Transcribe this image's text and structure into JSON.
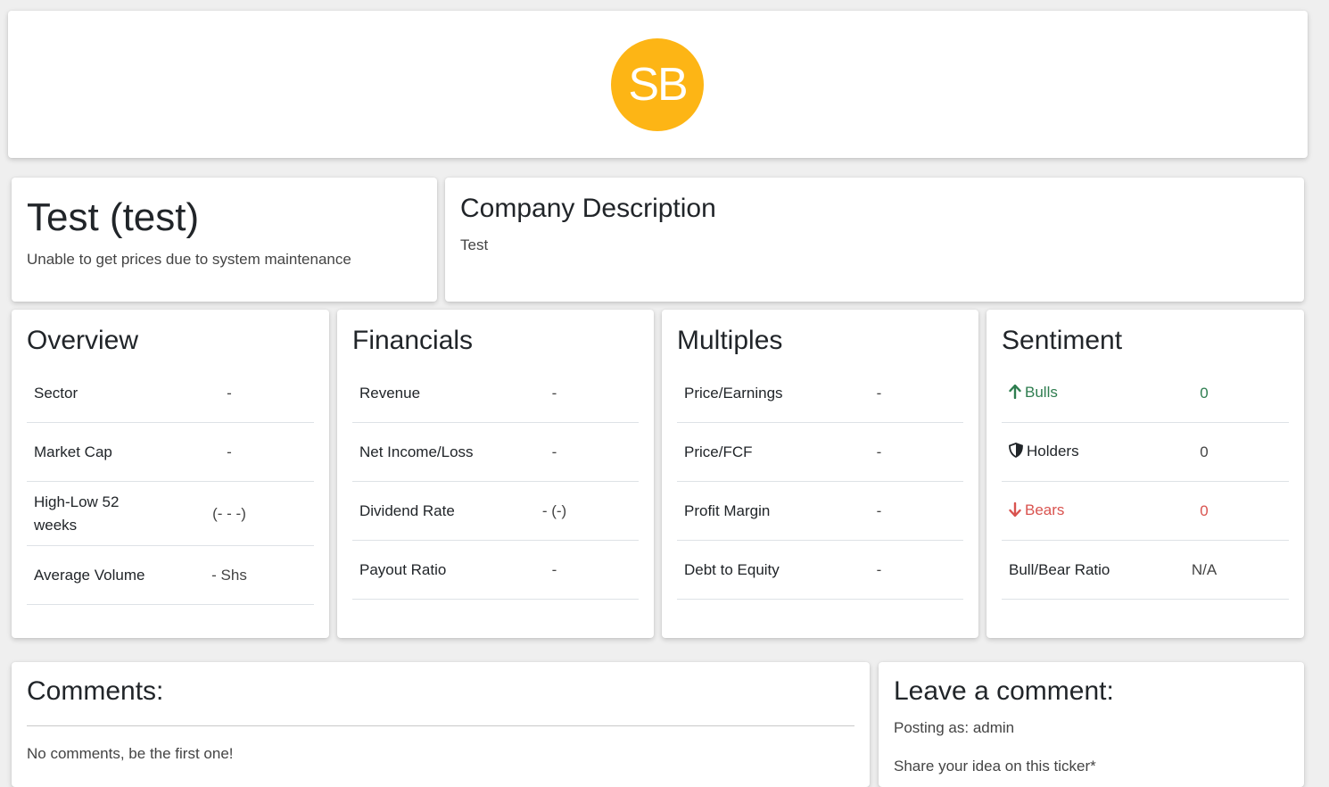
{
  "header": {
    "logo_text": "SB",
    "logo_color": "#fdb515"
  },
  "ticker": {
    "title": "Test (test)",
    "status": "Unable to get prices due to system maintenance"
  },
  "description": {
    "title": "Company Description",
    "text": "Test"
  },
  "overview": {
    "title": "Overview",
    "rows": [
      {
        "label": "Sector",
        "value": "-"
      },
      {
        "label": "Market Cap",
        "value": "-"
      },
      {
        "label": "High-Low 52 weeks",
        "value": "(- - -)"
      },
      {
        "label": "Average Volume",
        "value": "- Shs"
      }
    ]
  },
  "financials": {
    "title": "Financials",
    "rows": [
      {
        "label": "Revenue",
        "value": "-"
      },
      {
        "label": "Net Income/Loss",
        "value": "-"
      },
      {
        "label": "Dividend Rate",
        "value": "- (-)"
      },
      {
        "label": "Payout Ratio",
        "value": "-"
      }
    ]
  },
  "multiples": {
    "title": "Multiples",
    "rows": [
      {
        "label": "Price/Earnings",
        "value": "-"
      },
      {
        "label": "Price/FCF",
        "value": "-"
      },
      {
        "label": "Profit Margin",
        "value": "-"
      },
      {
        "label": "Debt to Equity",
        "value": "-"
      }
    ]
  },
  "sentiment": {
    "title": "Sentiment",
    "rows": [
      {
        "label": "Bulls",
        "value": "0",
        "icon": "arrow-up-icon",
        "color": "#2e7d4f"
      },
      {
        "label": "Holders",
        "value": "0",
        "icon": "shield-icon",
        "color": "#212529"
      },
      {
        "label": "Bears",
        "value": "0",
        "icon": "arrow-down-icon",
        "color": "#d9534f"
      },
      {
        "label": "Bull/Bear Ratio",
        "value": "N/A"
      }
    ]
  },
  "comments": {
    "title": "Comments:",
    "empty_text": "No comments, be the first one!"
  },
  "leave_comment": {
    "title": "Leave a comment:",
    "posting_as": "Posting as: admin",
    "idea_label": "Share your idea on this ticker*"
  }
}
